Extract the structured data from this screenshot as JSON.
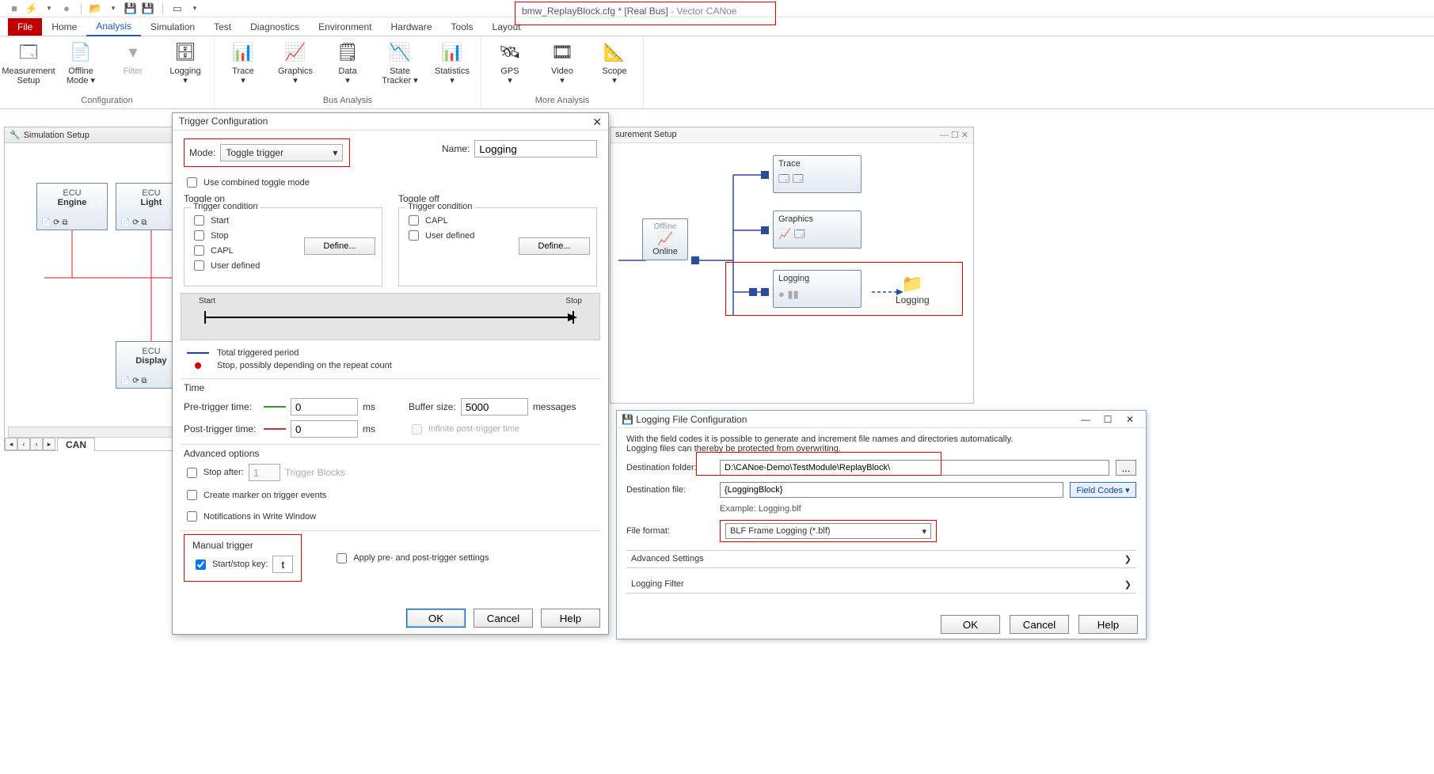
{
  "app": {
    "filename": "bmw_ReplayBlock.cfg *",
    "mode": "[Real Bus]",
    "product": "- Vector CANoe"
  },
  "tabs": {
    "file": "File",
    "home": "Home",
    "analysis": "Analysis",
    "simulation": "Simulation",
    "test": "Test",
    "diagnostics": "Diagnostics",
    "environment": "Environment",
    "hardware": "Hardware",
    "tools": "Tools",
    "layout": "Layout"
  },
  "ribbon": {
    "configuration": {
      "label": "Configuration",
      "measurement": "Measurement\nSetup",
      "offline": "Offline\nMode ▾",
      "filter": "Filter",
      "logging": "Logging\n▾"
    },
    "busanalysis": {
      "label": "Bus Analysis",
      "trace": "Trace\n▾",
      "graphics": "Graphics\n▾",
      "data": "Data\n▾",
      "state": "State\nTracker ▾",
      "statistics": "Statistics\n▾"
    },
    "more": {
      "label": "More Analysis",
      "gps": "GPS\n▾",
      "video": "Video\n▾",
      "scope": "Scope\n▾"
    }
  },
  "sim": {
    "title": "Simulation Setup",
    "ecu": "ECU",
    "engine": "Engine",
    "light": "Light",
    "display": "Display",
    "can": "CAN"
  },
  "meas": {
    "title": "surement Setup",
    "offline": "Offline",
    "online": "Online",
    "trace": "Trace",
    "graphics": "Graphics",
    "logging": "Logging",
    "logging2": "Logging"
  },
  "trig": {
    "title": "Trigger Configuration",
    "mode_lbl": "Mode:",
    "mode": "Toggle trigger",
    "name_lbl": "Name:",
    "name": "Logging",
    "combined": "Use combined toggle mode",
    "toggle_on": "Toggle on",
    "toggle_off": "Toggle off",
    "trigcond": "Trigger condition",
    "start": "Start",
    "stop": "Stop",
    "capl": "CAPL",
    "userdef": "User defined",
    "define": "Define...",
    "t_start": "Start",
    "t_stop": "Stop",
    "leg1": "Total triggered period",
    "leg2": "Stop, possibly depending on the repeat count",
    "time": "Time",
    "pre": "Pre-trigger time:",
    "post": "Post-trigger time:",
    "pre_v": "0",
    "post_v": "0",
    "ms": "ms",
    "buf": "Buffer size:",
    "buf_v": "5000",
    "msgs": "messages",
    "inf": "Infinite post-trigger time",
    "adv": "Advanced options",
    "stop_after": "Stop after:",
    "stop_after_v": "1",
    "stop_after_u": "Trigger Blocks",
    "marker": "Create marker on trigger events",
    "notif": "Notifications in Write Window",
    "manual": "Manual trigger",
    "startstop": "Start/stop key:",
    "key": "t",
    "apply": "Apply pre- and post-trigger settings",
    "ok": "OK",
    "cancel": "Cancel",
    "help": "Help"
  },
  "log": {
    "title": "Logging File Configuration",
    "desc1": "With the field codes it is possible to generate and increment file names and directories automatically.",
    "desc2": "Logging files can thereby be protected from overwriting.",
    "destfolder_lbl": "Destination folder:",
    "destfolder": "D:\\CANoe-Demo\\TestModule\\ReplayBlock\\",
    "destfile_lbl": "Destination file:",
    "destfile": "{LoggingBlock}",
    "example": "Example: Logging.blf",
    "format_lbl": "File format:",
    "format": "BLF Frame Logging (*.blf)",
    "fieldcodes": "Field Codes   ▾",
    "browse": "...",
    "adv": "Advanced Settings",
    "filter": "Logging Filter",
    "ok": "OK",
    "cancel": "Cancel",
    "help": "Help"
  }
}
